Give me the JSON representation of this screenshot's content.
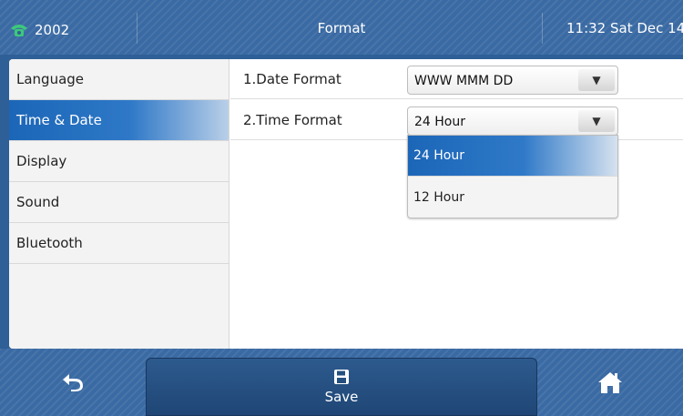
{
  "colors": {
    "bar_blue": "#3a6aa3",
    "active_blue": "#1c66b8",
    "phone_green": "#3cc97a"
  },
  "topbar": {
    "account": "2002",
    "account_icon": "phone-icon",
    "title": "Format",
    "clock": "11:32 Sat Dec 14"
  },
  "sidebar": {
    "items": [
      {
        "label": "Language",
        "active": false
      },
      {
        "label": "Time & Date",
        "active": true
      },
      {
        "label": "Display",
        "active": false
      },
      {
        "label": "Sound",
        "active": false
      },
      {
        "label": "Bluetooth",
        "active": false
      }
    ]
  },
  "settings": {
    "date_format": {
      "label": "1.Date Format",
      "value": "WWW MMM DD"
    },
    "time_format": {
      "label": "2.Time Format",
      "value": "24 Hour"
    }
  },
  "dropdown": {
    "options": [
      {
        "label": "24 Hour",
        "selected": true
      },
      {
        "label": "12 Hour",
        "selected": false
      }
    ]
  },
  "bottombar": {
    "back_icon": "back-icon",
    "save_label": "Save",
    "save_icon": "floppy-disk-icon",
    "home_icon": "home-icon"
  }
}
